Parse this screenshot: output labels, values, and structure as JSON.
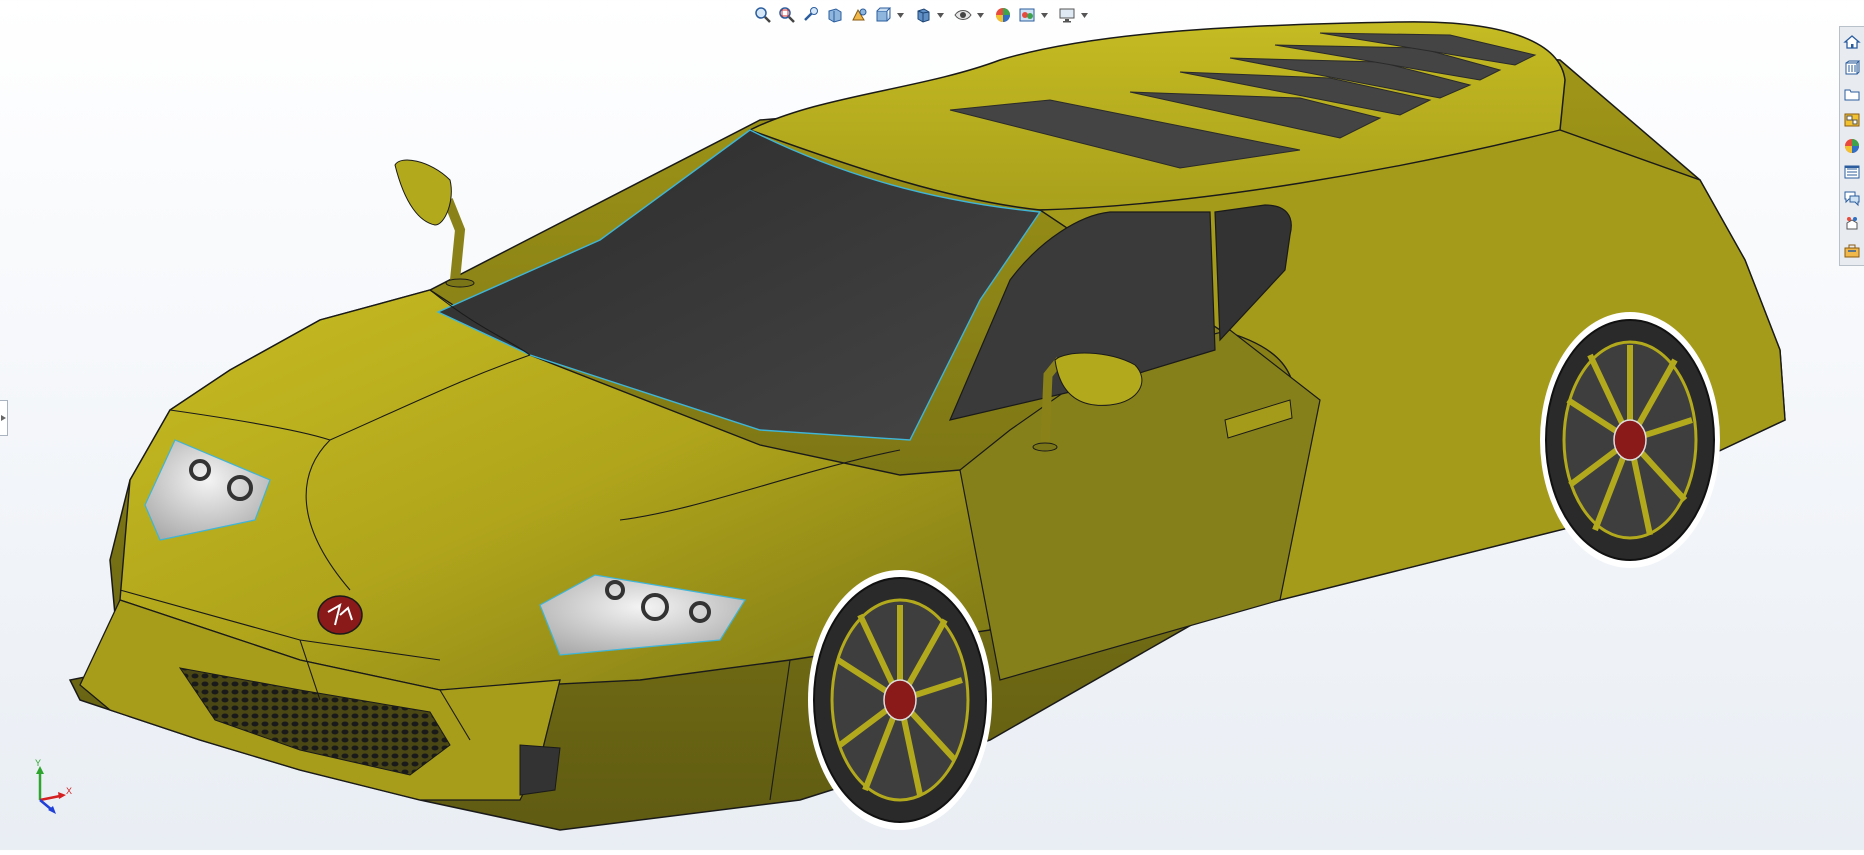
{
  "hud_toolbar": {
    "buttons": [
      {
        "name": "zoom-to-fit-icon"
      },
      {
        "name": "zoom-to-area-icon"
      },
      {
        "name": "previous-view-icon"
      },
      {
        "name": "section-view-icon"
      },
      {
        "name": "dynamic-annotation-views-icon"
      },
      {
        "name": "view-orientation-icon",
        "dropdown": true
      },
      {
        "name": "display-style-icon",
        "dropdown": true
      },
      {
        "name": "hide-show-items-icon",
        "dropdown": true
      },
      {
        "name": "edit-appearance-icon"
      },
      {
        "name": "apply-scene-icon",
        "dropdown": true
      },
      {
        "name": "view-settings-icon",
        "dropdown": true
      }
    ]
  },
  "task_pane": {
    "tabs": [
      {
        "name": "solidworks-resources-icon"
      },
      {
        "name": "design-library-icon"
      },
      {
        "name": "file-explorer-icon"
      },
      {
        "name": "view-palette-icon"
      },
      {
        "name": "appearances-scenes-icon"
      },
      {
        "name": "custom-properties-icon"
      },
      {
        "name": "solidworks-forum-icon"
      },
      {
        "name": "3d-content-central-icon"
      },
      {
        "name": "toolbox-icon"
      }
    ]
  },
  "model": {
    "body_color": "#b5ab1c",
    "body_shadow_color": "#6d6a16",
    "glass_color": "#3a3a3a",
    "wheel_color": "#2d2d2d",
    "badge_color": "#8a1a1a",
    "edge_color": "#1a1a1a",
    "silhouette_color": "#3fb5d8"
  },
  "triad": {
    "y_label": "Y",
    "x_label": "X",
    "y_color": "#2ea62e",
    "x_color": "#d42020",
    "z_color": "#2040d8"
  }
}
